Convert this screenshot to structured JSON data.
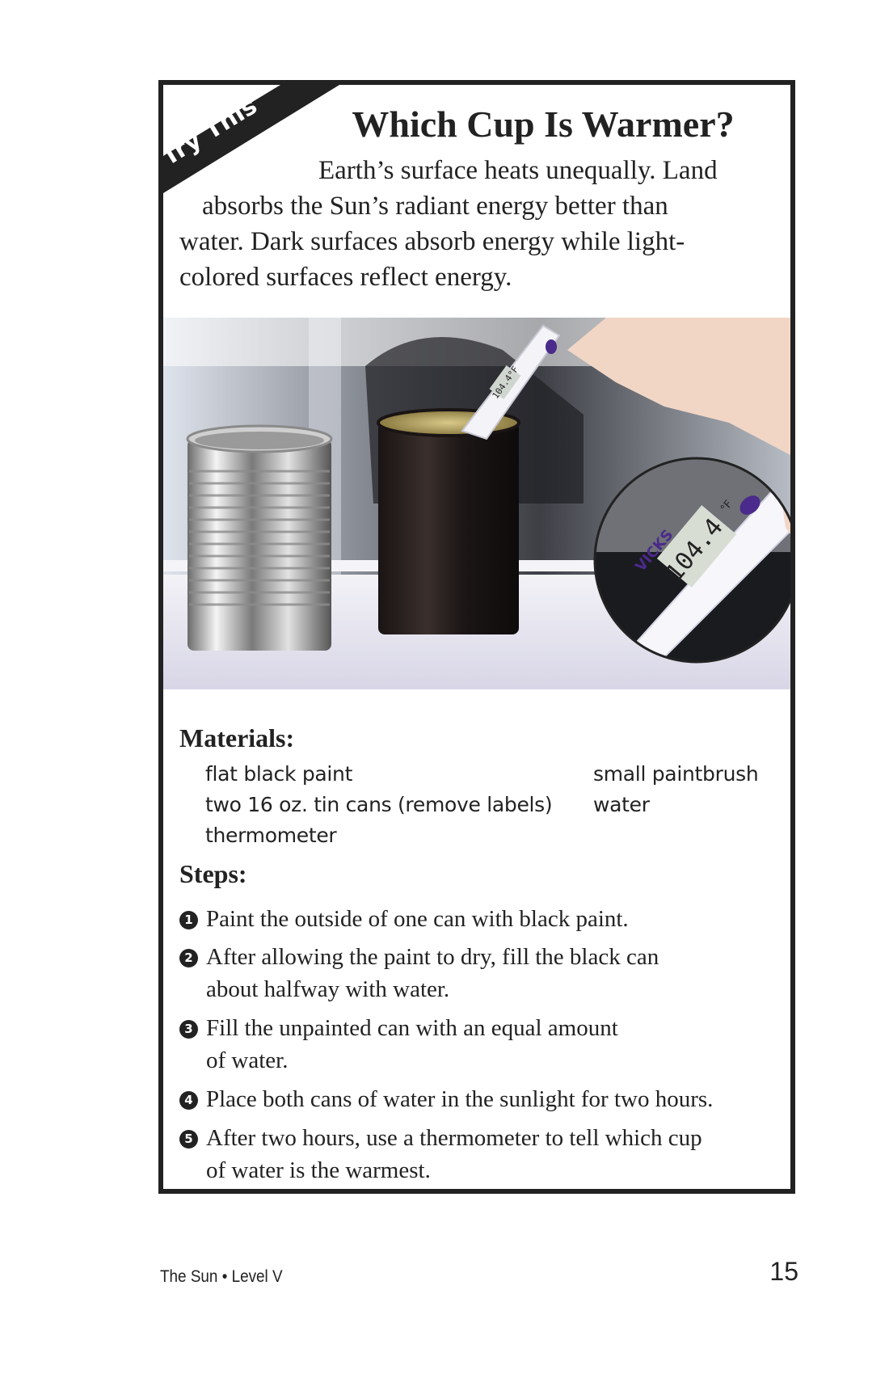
{
  "banner": {
    "label": "Try This"
  },
  "title": "Which Cup Is Warmer?",
  "intro": {
    "line1": "Earth’s surface heats unequally. Land",
    "line2": "absorbs the Sun’s radiant energy better than",
    "line3": "water. Dark surfaces absorb energy while light-",
    "line4": "colored surfaces reflect energy."
  },
  "photo": {
    "thermometer_brand": "VICKS",
    "small_reading": "104.4°F",
    "zoom_reading": "104.4",
    "zoom_unit": "°F"
  },
  "materials": {
    "heading": "Materials:",
    "items": [
      "flat black paint",
      "two 16 oz. tin cans (remove labels)",
      "thermometer",
      "small paintbrush",
      "water"
    ]
  },
  "steps": {
    "heading": "Steps:",
    "items": [
      {
        "num": "1",
        "line1": "Paint the outside of one can with black paint.",
        "line2": ""
      },
      {
        "num": "2",
        "line1": "After allowing the paint to dry, fill the black can",
        "line2": "about halfway with water."
      },
      {
        "num": "3",
        "line1": "Fill the unpainted can with an equal amount",
        "line2": "of water."
      },
      {
        "num": "4",
        "line1": "Place both cans of water in the sunlight for two hours.",
        "line2": ""
      },
      {
        "num": "5",
        "line1": "After two hours, use a thermometer to tell which cup",
        "line2": "of water is the warmest."
      }
    ]
  },
  "footer": {
    "book": "The Sun • Level V",
    "page": "15"
  },
  "colors": {
    "border": "#222222",
    "text": "#222222",
    "thermometer_accent": "#4a2a8a"
  }
}
